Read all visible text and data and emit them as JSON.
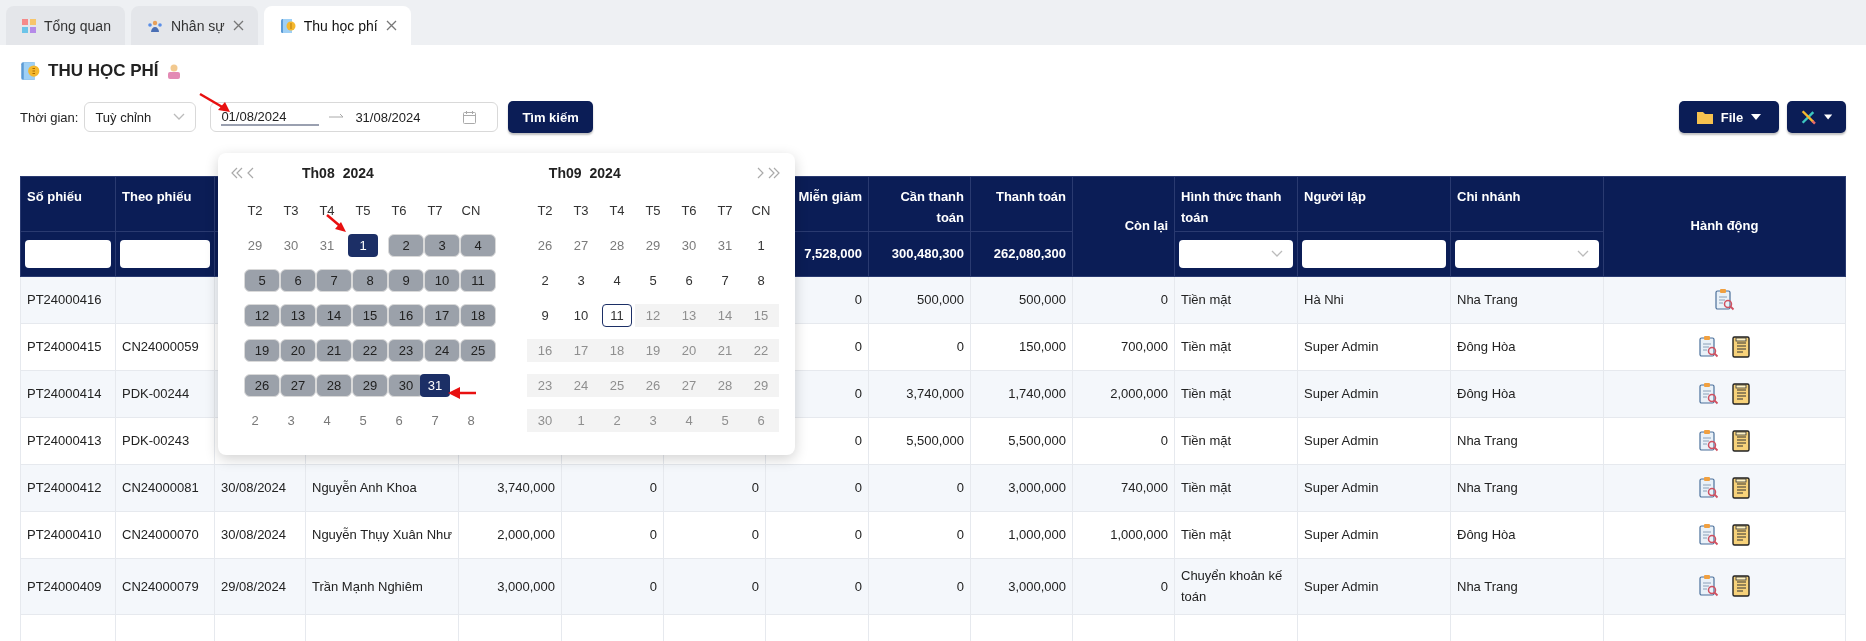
{
  "tabs": [
    {
      "label": "Tổng quan",
      "closable": false,
      "selected": false
    },
    {
      "label": "Nhân sự",
      "closable": true,
      "selected": false
    },
    {
      "label": "Thu học phí",
      "closable": true,
      "selected": true
    }
  ],
  "page_title": "THU HỌC PHÍ",
  "filters": {
    "time_label": "Thời gian:",
    "period": "Tuỳ chỉnh",
    "date_from": "01/08/2024",
    "date_to": "31/08/2024",
    "search_button": "Tìm kiếm",
    "file_button": "File"
  },
  "calendar": {
    "months": [
      {
        "month": "Th08",
        "year": "2024",
        "weekdays": [
          "T2",
          "T3",
          "T4",
          "T5",
          "T6",
          "T7",
          "CN"
        ],
        "weeks": [
          [
            {
              "label": "29",
              "kind": "outside"
            },
            {
              "label": "30",
              "kind": "outside"
            },
            {
              "label": "31",
              "kind": "outside"
            },
            {
              "label": "1",
              "kind": "selected"
            },
            {
              "label": "2",
              "kind": "range"
            },
            {
              "label": "3",
              "kind": "range"
            },
            {
              "label": "4",
              "kind": "range"
            }
          ],
          [
            {
              "label": "5",
              "kind": "range"
            },
            {
              "label": "6",
              "kind": "range"
            },
            {
              "label": "7",
              "kind": "range"
            },
            {
              "label": "8",
              "kind": "range"
            },
            {
              "label": "9",
              "kind": "range"
            },
            {
              "label": "10",
              "kind": "range"
            },
            {
              "label": "11",
              "kind": "range"
            }
          ],
          [
            {
              "label": "12",
              "kind": "range"
            },
            {
              "label": "13",
              "kind": "range"
            },
            {
              "label": "14",
              "kind": "range"
            },
            {
              "label": "15",
              "kind": "range"
            },
            {
              "label": "16",
              "kind": "range"
            },
            {
              "label": "17",
              "kind": "range"
            },
            {
              "label": "18",
              "kind": "range"
            }
          ],
          [
            {
              "label": "19",
              "kind": "range"
            },
            {
              "label": "20",
              "kind": "range"
            },
            {
              "label": "21",
              "kind": "range"
            },
            {
              "label": "22",
              "kind": "range"
            },
            {
              "label": "23",
              "kind": "range"
            },
            {
              "label": "24",
              "kind": "range"
            },
            {
              "label": "25",
              "kind": "range"
            }
          ],
          [
            {
              "label": "26",
              "kind": "range"
            },
            {
              "label": "27",
              "kind": "range"
            },
            {
              "label": "28",
              "kind": "range"
            },
            {
              "label": "29",
              "kind": "range"
            },
            {
              "label": "30",
              "kind": "range"
            },
            {
              "label": "31",
              "kind": "selected"
            },
            {
              "kind": "blank"
            }
          ],
          [
            {
              "label": "2",
              "kind": "outside"
            },
            {
              "label": "3",
              "kind": "outside"
            },
            {
              "label": "4",
              "kind": "outside"
            },
            {
              "label": "5",
              "kind": "outside"
            },
            {
              "label": "6",
              "kind": "outside"
            },
            {
              "label": "7",
              "kind": "outside"
            },
            {
              "label": "8",
              "kind": "outside"
            }
          ]
        ]
      },
      {
        "month": "Th09",
        "year": "2024",
        "weekdays": [
          "T2",
          "T3",
          "T4",
          "T5",
          "T6",
          "T7",
          "CN"
        ],
        "weeks": [
          [
            {
              "label": "26",
              "kind": "outside"
            },
            {
              "label": "27",
              "kind": "outside"
            },
            {
              "label": "28",
              "kind": "outside"
            },
            {
              "label": "29",
              "kind": "outside"
            },
            {
              "label": "30",
              "kind": "outside"
            },
            {
              "label": "31",
              "kind": "outside"
            },
            {
              "label": "1",
              "kind": "normal"
            }
          ],
          [
            {
              "label": "2",
              "kind": "normal"
            },
            {
              "label": "3",
              "kind": "normal"
            },
            {
              "label": "4",
              "kind": "normal"
            },
            {
              "label": "5",
              "kind": "normal"
            },
            {
              "label": "6",
              "kind": "normal"
            },
            {
              "label": "7",
              "kind": "normal"
            },
            {
              "label": "8",
              "kind": "normal"
            }
          ],
          [
            {
              "label": "9",
              "kind": "normal"
            },
            {
              "label": "10",
              "kind": "normal"
            },
            {
              "label": "11",
              "kind": "today"
            },
            {
              "label": "12",
              "kind": "disabled"
            },
            {
              "label": "13",
              "kind": "disabled"
            },
            {
              "label": "14",
              "kind": "disabled"
            },
            {
              "label": "15",
              "kind": "disabled"
            }
          ],
          [
            {
              "label": "16",
              "kind": "disabled"
            },
            {
              "label": "17",
              "kind": "disabled"
            },
            {
              "label": "18",
              "kind": "disabled"
            },
            {
              "label": "19",
              "kind": "disabled"
            },
            {
              "label": "20",
              "kind": "disabled"
            },
            {
              "label": "21",
              "kind": "disabled"
            },
            {
              "label": "22",
              "kind": "disabled"
            }
          ],
          [
            {
              "label": "23",
              "kind": "disabled"
            },
            {
              "label": "24",
              "kind": "disabled"
            },
            {
              "label": "25",
              "kind": "disabled"
            },
            {
              "label": "26",
              "kind": "disabled"
            },
            {
              "label": "27",
              "kind": "disabled"
            },
            {
              "label": "28",
              "kind": "disabled"
            },
            {
              "label": "29",
              "kind": "disabled"
            }
          ],
          [
            {
              "label": "30",
              "kind": "disabled"
            },
            {
              "label": "1",
              "kind": "disabled"
            },
            {
              "label": "2",
              "kind": "disabled"
            },
            {
              "label": "3",
              "kind": "disabled"
            },
            {
              "label": "4",
              "kind": "disabled"
            },
            {
              "label": "5",
              "kind": "disabled"
            },
            {
              "label": "6",
              "kind": "disabled"
            }
          ]
        ]
      }
    ]
  },
  "table": {
    "columns": [
      {
        "label": "Số phiếu",
        "kind": "input"
      },
      {
        "label": "Theo phiếu",
        "kind": "input"
      },
      {},
      {},
      {},
      {},
      {},
      {
        "label": "Miễn giảm",
        "kind": "total",
        "total": "7,528,000"
      },
      {
        "label": "Cần thanh toán",
        "kind": "total",
        "total": "300,480,300"
      },
      {
        "label": "Thanh toán",
        "kind": "total",
        "total": "262,080,300"
      },
      {
        "label": "Còn lại",
        "kind": "span"
      },
      {
        "label": "Hình thức thanh toán",
        "kind": "select"
      },
      {
        "label": "Người lập",
        "kind": "input"
      },
      {
        "label": "Chi nhánh",
        "kind": "select"
      },
      {
        "label": "Hành động",
        "kind": "span"
      }
    ],
    "rows": [
      {
        "cells": [
          "PT24000416",
          null,
          null,
          null,
          null,
          null,
          null,
          "0",
          "500,000",
          "500,000",
          "0",
          "Tiền mặt",
          "Hà Nhi",
          "Nha Trang"
        ],
        "actions": [
          {
            "kind": "view"
          }
        ]
      },
      {
        "cells": [
          "PT24000415",
          "CN24000059",
          null,
          null,
          null,
          null,
          null,
          "0",
          "0",
          "150,000",
          "700,000",
          "Tiền mặt",
          "Super Admin",
          "Đông Hòa"
        ],
        "actions": [
          {
            "kind": "view"
          },
          {
            "kind": "info"
          }
        ]
      },
      {
        "cells": [
          "PT24000414",
          "PDK-00244",
          null,
          null,
          null,
          null,
          null,
          "0",
          "3,740,000",
          "1,740,000",
          "2,000,000",
          "Tiền mặt",
          "Super Admin",
          "Đông Hòa"
        ],
        "actions": [
          {
            "kind": "view"
          },
          {
            "kind": "info"
          }
        ]
      },
      {
        "cells": [
          "PT24000413",
          "PDK-00243",
          null,
          null,
          null,
          null,
          null,
          "0",
          "5,500,000",
          "5,500,000",
          "0",
          "Tiền mặt",
          "Super Admin",
          "Nha Trang"
        ],
        "actions": [
          {
            "kind": "view"
          },
          {
            "kind": "info"
          }
        ]
      },
      {
        "cells": [
          "PT24000412",
          "CN24000081",
          "30/08/2024",
          "Nguyễn Anh Khoa",
          "3,740,000",
          "0",
          "0",
          "0",
          "0",
          "3,000,000",
          "740,000",
          "Tiền mặt",
          "Super Admin",
          "Nha Trang"
        ],
        "actions": [
          {
            "kind": "view"
          },
          {
            "kind": "info"
          }
        ]
      },
      {
        "cells": [
          "PT24000410",
          "CN24000070",
          "30/08/2024",
          "Nguyễn Thụy Xuân Như",
          "2,000,000",
          "0",
          "0",
          "0",
          "0",
          "1,000,000",
          "1,000,000",
          "Tiền mặt",
          "Super Admin",
          "Đông Hòa"
        ],
        "actions": [
          {
            "kind": "view"
          },
          {
            "kind": "info"
          }
        ]
      },
      {
        "cells": [
          "PT24000409",
          "CN24000079",
          "29/08/2024",
          "Trần Mạnh Nghiêm",
          "3,000,000",
          "0",
          "0",
          "0",
          "0",
          "3,000,000",
          "0",
          "Chuyển khoản kế toán",
          "Super Admin",
          "Nha Trang"
        ],
        "actions": [
          {
            "kind": "view"
          },
          {
            "kind": "info"
          }
        ]
      }
    ]
  }
}
